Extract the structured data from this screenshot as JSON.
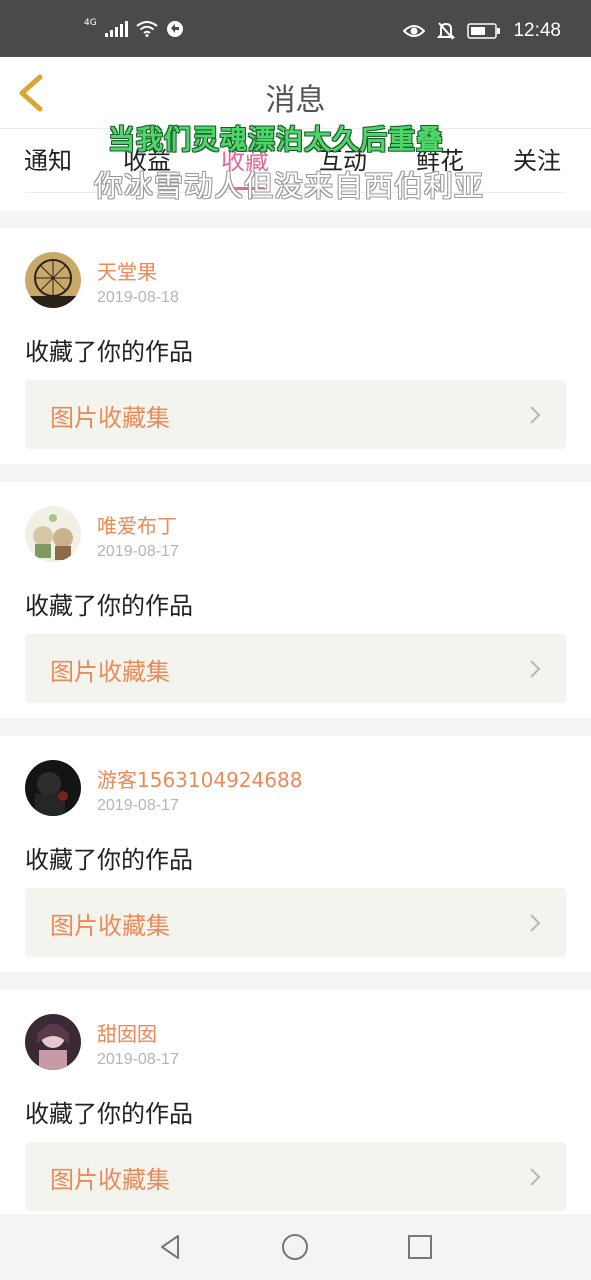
{
  "status_bar": {
    "network": "4G",
    "time": "12:48",
    "icons": [
      "signal-icon",
      "wifi-icon",
      "sync-icon",
      "eye-icon",
      "bell-off-icon",
      "battery-icon"
    ]
  },
  "header": {
    "title": "消息",
    "back_icon": "chevron-left-icon"
  },
  "tabs": [
    {
      "label": "通知"
    },
    {
      "label": "收益"
    },
    {
      "label": "收藏",
      "active": true
    },
    {
      "label": "互动"
    },
    {
      "label": "鲜花"
    },
    {
      "label": "关注"
    }
  ],
  "lyrics": {
    "line1": "当我们灵魂漂泊太久后重叠",
    "line2": "你冰雪动人但没来自西伯利亚"
  },
  "notifications": [
    {
      "username": "天堂果",
      "date": "2019-08-18",
      "action": "收藏了你的作品",
      "collection": "图片收藏集"
    },
    {
      "username": "唯爱布丁",
      "date": "2019-08-17",
      "action": "收藏了你的作品",
      "collection": "图片收藏集"
    },
    {
      "username": "游客1563104924688",
      "date": "2019-08-17",
      "action": "收藏了你的作品",
      "collection": "图片收藏集"
    },
    {
      "username": "甜囡囡",
      "date": "2019-08-17",
      "action": "收藏了你的作品",
      "collection": "图片收藏集"
    }
  ],
  "colors": {
    "accent_pink": "#e8669a",
    "username_orange": "#e98b5a",
    "back_arrow": "#d9a62e",
    "lyric_green": "#4fd66a"
  },
  "nav_bar": {
    "buttons": [
      "back-triangle-icon",
      "home-circle-icon",
      "recents-square-icon"
    ]
  }
}
